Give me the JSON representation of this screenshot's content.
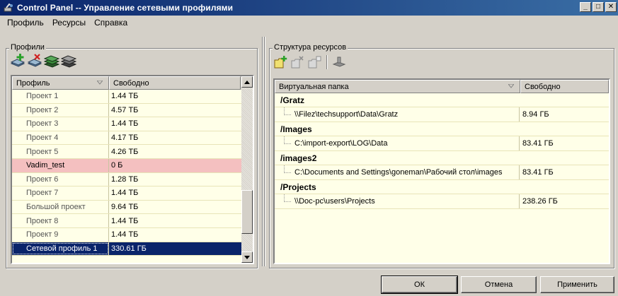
{
  "window": {
    "title": "Control Panel -- Управление сетевыми профилями",
    "min_glyph": "_",
    "max_glyph": "□",
    "close_glyph": "✕"
  },
  "menu": [
    "Профиль",
    "Ресурсы",
    "Справка"
  ],
  "profiles_panel": {
    "group_label": "Профили",
    "toolbar_icons": [
      "add-profile-icon",
      "delete-profile-icon",
      "profiles-stack-icon",
      "profiles-stack-gray-icon"
    ],
    "columns": [
      "Профиль",
      "Свободно"
    ],
    "rows": [
      {
        "name": "Проект 1",
        "free": "1.44 ТБ",
        "state": "normal"
      },
      {
        "name": "Проект 2",
        "free": "4.57 ТБ",
        "state": "normal"
      },
      {
        "name": "Проект 3",
        "free": "1.44 ТБ",
        "state": "normal"
      },
      {
        "name": "Проект 4",
        "free": "4.17 ТБ",
        "state": "normal"
      },
      {
        "name": "Проект 5",
        "free": "4.26 ТБ",
        "state": "normal"
      },
      {
        "name": "Vadim_test",
        "free": "0 Б",
        "state": "alert"
      },
      {
        "name": "Проект 6",
        "free": "1.28 ТБ",
        "state": "normal"
      },
      {
        "name": "Проект 7",
        "free": "1.44 ТБ",
        "state": "normal"
      },
      {
        "name": "Большой проект",
        "free": "9.64 ТБ",
        "state": "normal"
      },
      {
        "name": "Проект 8",
        "free": "1.44 ТБ",
        "state": "normal"
      },
      {
        "name": "Проект 9",
        "free": "1.44 ТБ",
        "state": "normal"
      },
      {
        "name": "Сетевой профиль 1",
        "free": "330.61 ГБ",
        "state": "selected"
      }
    ],
    "scroll_position": 0.85
  },
  "resources_panel": {
    "group_label": "Структура ресурсов",
    "toolbar_icons": [
      "add-folder-icon",
      "remove-folder-icon",
      "edit-folder-icon",
      "connect-icon"
    ],
    "columns": [
      "Виртуальная папка",
      "Свободно"
    ],
    "folders": [
      {
        "name": "/Gratz",
        "path": "\\\\Filez\\techsupport\\Data\\Gratz",
        "free": "8.94 ГБ"
      },
      {
        "name": "/Images",
        "path": "C:\\import-export\\LOG\\Data",
        "free": "83.41 ГБ"
      },
      {
        "name": "/images2",
        "path": "C:\\Documents and Settings\\goneman\\Рабочий стол\\images",
        "free": "83.41 ГБ"
      },
      {
        "name": "/Projects",
        "path": "\\\\Doc-pc\\users\\Projects",
        "free": "238.26 ГБ"
      }
    ]
  },
  "buttons": {
    "ok": "ОК",
    "cancel": "Отмена",
    "apply": "Применить"
  },
  "colors": {
    "title_start": "#0a246a",
    "title_end": "#3a6ea5",
    "list_bg": "#ffffe8",
    "alert_row": "#f4c0c0",
    "selected_row": "#0a246a"
  }
}
